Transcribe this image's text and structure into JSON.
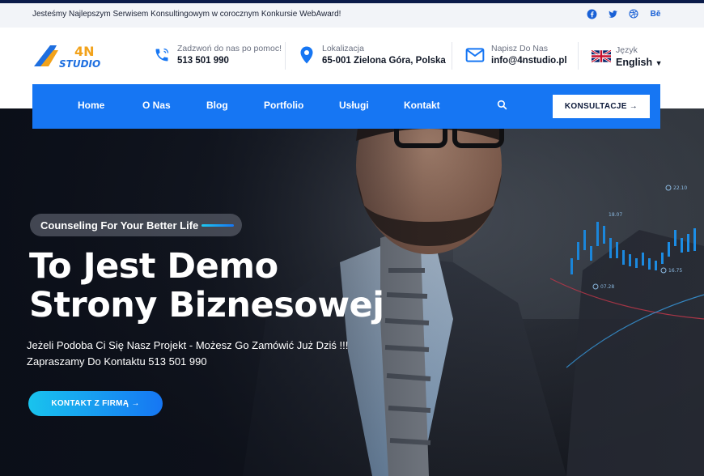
{
  "topbar": {
    "message": "Jesteśmy Najlepszym Serwisem Konsultingowym w corocznym Konkursie WebAward!",
    "socials": [
      {
        "icon": "facebook-icon",
        "glyph": "f"
      },
      {
        "icon": "twitter-icon",
        "glyph": "t"
      },
      {
        "icon": "dribbble-icon",
        "glyph": "◎"
      },
      {
        "icon": "behance-icon",
        "glyph": "Bē"
      }
    ]
  },
  "header": {
    "logo": {
      "top": "4N",
      "bottom": "STUDIO"
    },
    "phone": {
      "label": "Zadzwoń do nas po pomoc!",
      "value": "513 501 990"
    },
    "location": {
      "label": "Lokalizacja",
      "value": "65-001 Zielona Góra, Polska"
    },
    "email": {
      "label": "Napisz Do Nas",
      "value": "info@4nstudio.pl"
    },
    "language": {
      "label": "Język",
      "value": "English"
    }
  },
  "nav": {
    "items": [
      {
        "label": "Home"
      },
      {
        "label": "O Nas"
      },
      {
        "label": "Blog"
      },
      {
        "label": "Portfolio"
      },
      {
        "label": "Usługi"
      },
      {
        "label": "Kontakt"
      }
    ],
    "cta_label": "KONSULTACJE →"
  },
  "hero": {
    "badge": "Counseling For Your Better Life",
    "title_line1": "To Jest Demo",
    "title_line2": "Strony Biznesowej",
    "desc_line1": "Jeżeli Podoba Ci Się Nasz Projekt - Możesz Go Zamówić Już Dziś !!!",
    "desc_line2": "Zapraszamy Do Kontaktu 513 501 990",
    "button_label": "KONTAKT Z FIRMĄ →"
  },
  "colors": {
    "accent": "#1676f3",
    "accent_light": "#19c3ee",
    "navy": "#0b1c4a"
  }
}
